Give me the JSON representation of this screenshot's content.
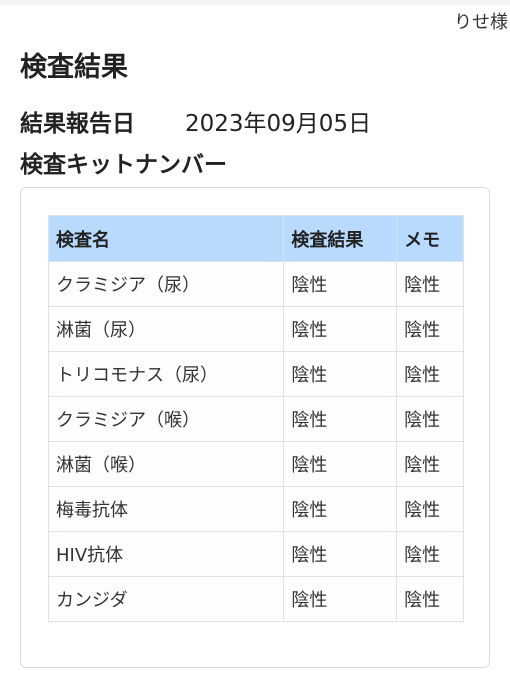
{
  "header": {
    "user_name": "りせ様"
  },
  "page": {
    "title": "検査結果",
    "report_date_label": "結果報告日",
    "report_date_value": "2023年09月05日",
    "kit_number_label": "検査キットナンバー"
  },
  "table": {
    "columns": [
      "検査名",
      "検査結果",
      "メモ"
    ],
    "header_color": "#b8dafe",
    "rows": [
      {
        "name": "クラミジア（尿）",
        "result": "陰性",
        "memo": "陰性"
      },
      {
        "name": "淋菌（尿）",
        "result": "陰性",
        "memo": "陰性"
      },
      {
        "name": "トリコモナス（尿）",
        "result": "陰性",
        "memo": "陰性"
      },
      {
        "name": "クラミジア（喉）",
        "result": "陰性",
        "memo": "陰性"
      },
      {
        "name": "淋菌（喉）",
        "result": "陰性",
        "memo": "陰性"
      },
      {
        "name": "梅毒抗体",
        "result": "陰性",
        "memo": "陰性"
      },
      {
        "name": "HIV抗体",
        "result": "陰性",
        "memo": "陰性"
      },
      {
        "name": "カンジダ",
        "result": "陰性",
        "memo": "陰性"
      }
    ]
  }
}
